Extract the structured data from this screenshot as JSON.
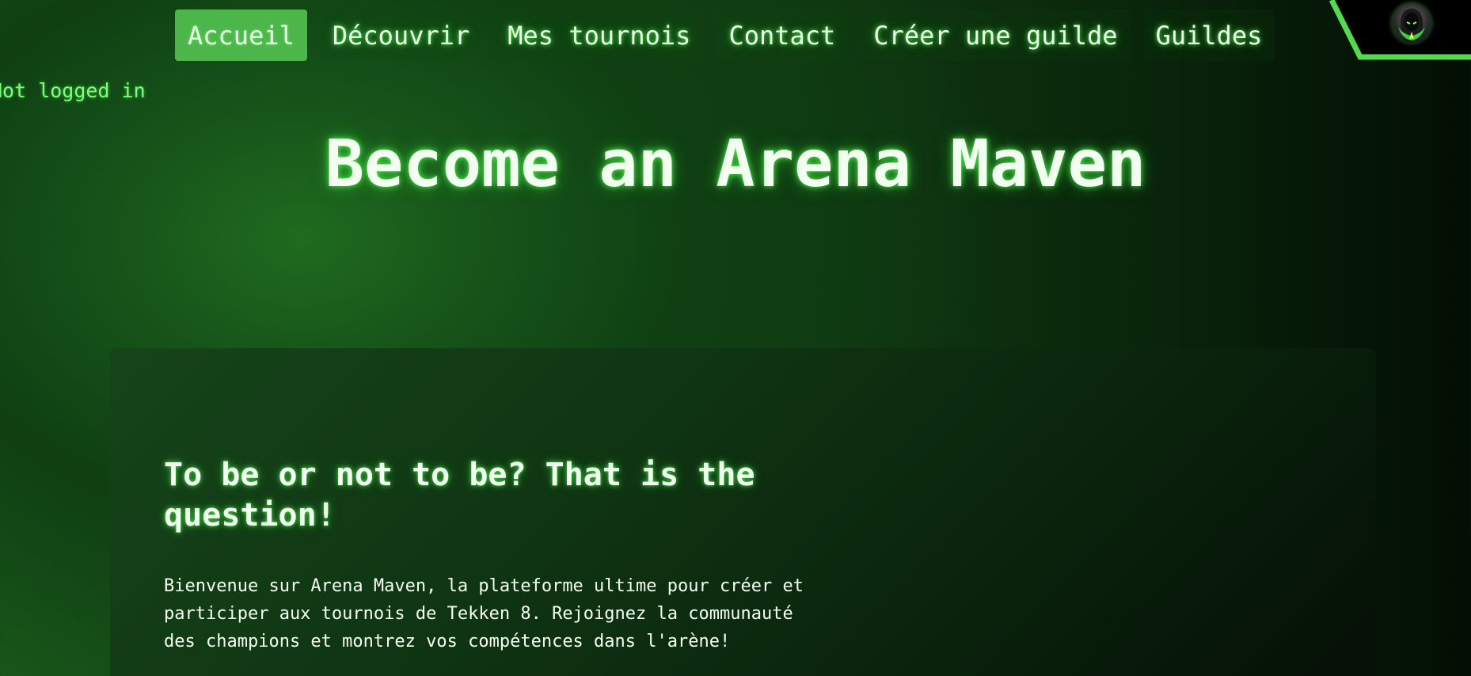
{
  "nav": {
    "items": [
      {
        "label": "Accueil",
        "active": true
      },
      {
        "label": "Découvrir",
        "active": false
      },
      {
        "label": "Mes tournois",
        "active": false
      },
      {
        "label": "Contact",
        "active": false
      },
      {
        "label": "Créer une guilde",
        "active": false
      },
      {
        "label": "Guildes",
        "active": false
      }
    ]
  },
  "user": {
    "status": "Not logged in",
    "avatar_icon": "hooded-figure-avatar-icon"
  },
  "hero": {
    "title": "Become an Arena Maven"
  },
  "panel": {
    "heading": "To be or not to be? That is the question!",
    "body": "Bienvenue sur Arena Maven, la plateforme ultime pour créer et participer aux tournois de Tekken 8. Rejoignez la communauté des champions et montrez vos compétences dans l'arène!"
  },
  "colors": {
    "accent": "#4cb64a",
    "glow": "#5aff5a",
    "corner_stroke": "#55d94f"
  }
}
